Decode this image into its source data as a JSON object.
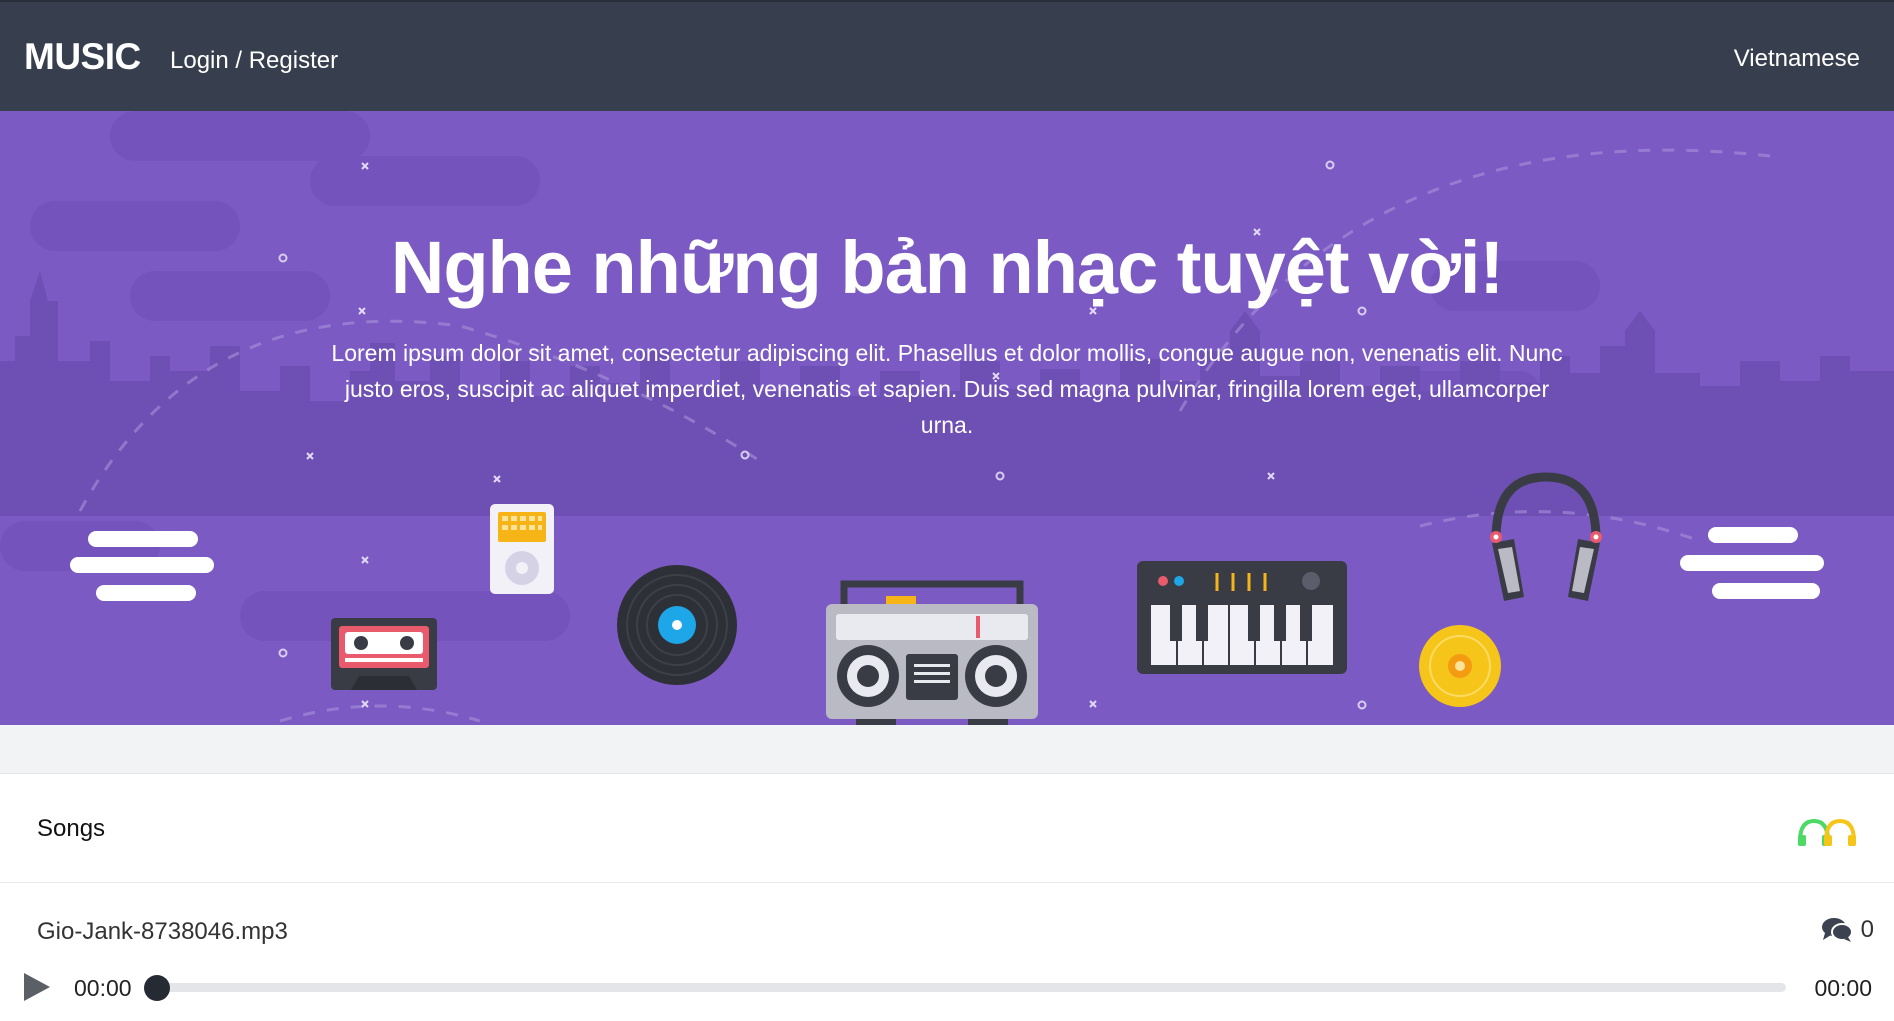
{
  "nav": {
    "brand": "MUSIC",
    "login_register": "Login / Register",
    "language": "Vietnamese"
  },
  "hero": {
    "title": "Nghe những bản nhạc tuyệt vời!",
    "text": "Lorem ipsum dolor sit amet, consectetur adipiscing elit. Phasellus et dolor mollis, congue augue non, venenatis elit. Nunc justo eros, suscipit ac aliquet imperdiet, venenatis et sapien. Duis sed magna pulvinar, fringilla lorem eget, ullamcorper urna.",
    "illustrations": [
      "cassette-icon",
      "ipod-icon",
      "vinyl-record-icon",
      "boombox-icon",
      "keyboard-synth-icon",
      "headphones-icon",
      "cd-icon"
    ],
    "colors": {
      "background": "#7c5ac3",
      "skyline": "#6e4fb3"
    }
  },
  "songs": {
    "title": "Songs",
    "header_icon": "headphones-pair-icon",
    "items": [
      {
        "name": "Gio-Jank-8738046.mp3",
        "comments": "0",
        "icon": "comments-icon"
      }
    ]
  },
  "player": {
    "current_time": "00:00",
    "duration": "00:00",
    "progress": 0,
    "play_icon": "play-icon"
  },
  "colors": {
    "navbar": "#373f4e",
    "accent_green": "#4cd964",
    "accent_yellow": "#f5c518"
  }
}
